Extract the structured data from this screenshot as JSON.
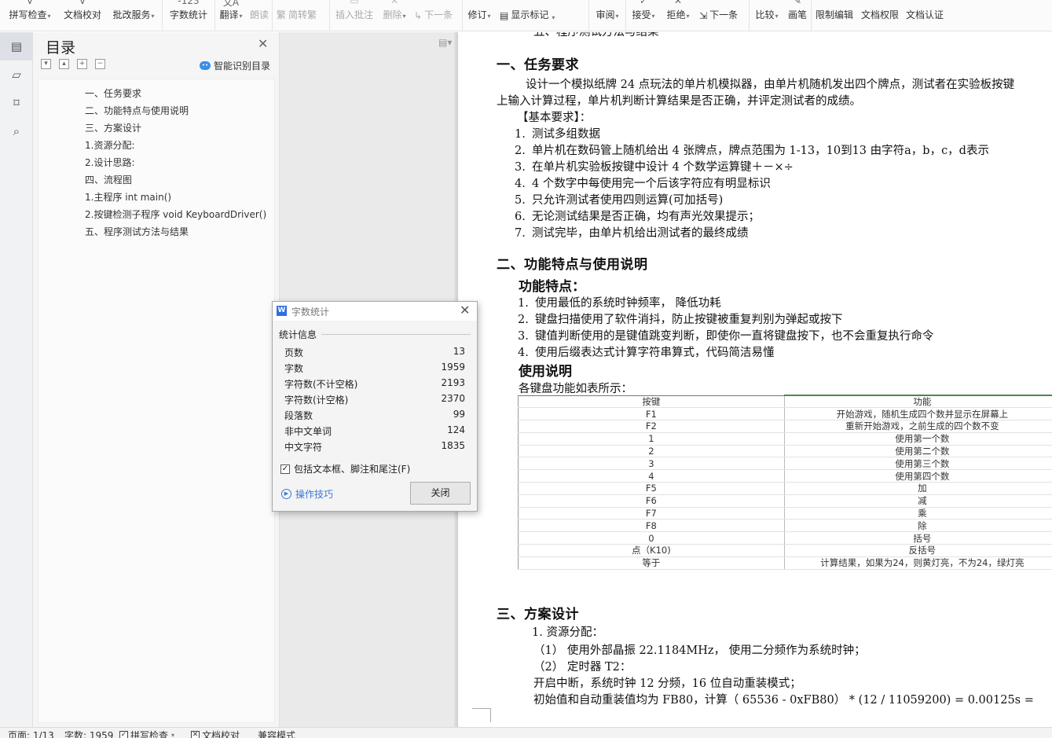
{
  "ribbon": {
    "spell_check": "拼写检查",
    "doc_proofread": "文档校对",
    "annotate_service": "批改服务",
    "word_count": "字数统计",
    "translate": "翻译",
    "read_aloud": "朗读",
    "simp_trad": "简转繁",
    "insert_comment": "插入批注",
    "delete": "删除",
    "next_item": "下一条",
    "revise": "修订",
    "show_marks": "显示标记",
    "review": "审阅",
    "accept": "接受",
    "reject": "拒绝",
    "next_change": "下一条",
    "compare": "比较",
    "ink": "画笔",
    "restrict_edit": "限制编辑",
    "doc_rights": "文档权限",
    "doc_auth": "文档认证"
  },
  "toc": {
    "title": "目录",
    "smart_label": "智能识别目录",
    "items": [
      "一、任务要求",
      "二、功能特点与使用说明",
      "三、方案设计",
      "1.资源分配:",
      "2.设计思路:",
      "四、流程图",
      "1.主程序 int main()",
      "2.按键检测子程序 void KeyboardDriver()",
      "五、程序测试方法与结果"
    ]
  },
  "dialog": {
    "title": "字数统计",
    "section": "统计信息",
    "stats": [
      {
        "label": "页数",
        "value": "13"
      },
      {
        "label": "字数",
        "value": "1959"
      },
      {
        "label": "字符数(不计空格)",
        "value": "2193"
      },
      {
        "label": "字符数(计空格)",
        "value": "2370"
      },
      {
        "label": "段落数",
        "value": "99"
      },
      {
        "label": "非中文单词",
        "value": "124"
      },
      {
        "label": "中文字符",
        "value": "1835"
      }
    ],
    "include_label": "包括文本框、脚注和尾注(F)",
    "tips": "操作技巧",
    "close": "关闭"
  },
  "doc": {
    "top_partial": "五、程序测试方法与结果",
    "h_task": "一、任务要求",
    "task_p1a": "设计一个模拟纸牌 24 点玩法的单片机模拟器，由单片机随机发出四个牌点，测试者在实验板按键",
    "task_p1b": "上输入计算过程，单片机判断计算结果是否正确，并评定测试者的成绩。",
    "basic_req": "【基本要求】：",
    "req": [
      "测试多组数据",
      "单片机在数码管上随机给出 4 张牌点，牌点范围为 1-13，10到13 由字符a，b，c，d表示",
      "在单片机实验板按键中设计 4 个数学运算键＋－×÷",
      "4 个数字中每使用完一个后该字符应有明显标识",
      "只允许测试者使用四则运算(可加括号)",
      "无论测试结果是否正确，均有声光效果提示；",
      "测试完毕，由单片机给出测试者的最终成绩"
    ],
    "h_feature": "二、功能特点与使用说明",
    "feature_title": "功能特点：",
    "features": [
      "使用最低的系统时钟频率， 降低功耗",
      "键盘扫描使用了软件消抖，防止按键被重复判别为弹起或按下",
      "键值判断使用的是键值跳变判断，即使你一直将键盘按下，也不会重复执行命令",
      "使用后缀表达式计算字符串算式，代码简洁易懂"
    ],
    "usage_title": "使用说明",
    "usage_intro": "各键盘功能如表所示：",
    "table_headers": [
      "按键",
      "功能"
    ],
    "table_rows": [
      [
        "F1",
        "开始游戏，随机生成四个数并显示在屏幕上"
      ],
      [
        "F2",
        "重新开始游戏，之前生成的四个数不变"
      ],
      [
        "1",
        "使用第一个数"
      ],
      [
        "2",
        "使用第二个数"
      ],
      [
        "3",
        "使用第三个数"
      ],
      [
        "4",
        "使用第四个数"
      ],
      [
        "F5",
        "加"
      ],
      [
        "F6",
        "减"
      ],
      [
        "F7",
        "乘"
      ],
      [
        "F8",
        "除"
      ],
      [
        "0",
        "括号"
      ],
      [
        "点（K10)",
        "反括号"
      ],
      [
        "等于",
        "计算结果，如果为24，则黄灯亮，不为24，绿灯亮"
      ]
    ],
    "h_design": "三、方案设计",
    "res_title": "1. 资源分配：",
    "res_1": "（1） 使用外部晶振 22.1184MHz， 使用二分频作为系统时钟；",
    "res_2": "（2） 定时器 T2：",
    "res_3": "开启中断，系统时钟 12 分频，16 位自动重装模式；",
    "res_4": "初始值和自动重装值均为 FB80，计算（ 65536 - 0xFB80） * (12 / 11059200) = 0.00125s ="
  },
  "status": {
    "page": "页面: 1/13",
    "words": "字数: 1959",
    "spell": "拼写检查",
    "proof": "文档校对",
    "compat": "兼容模式"
  }
}
